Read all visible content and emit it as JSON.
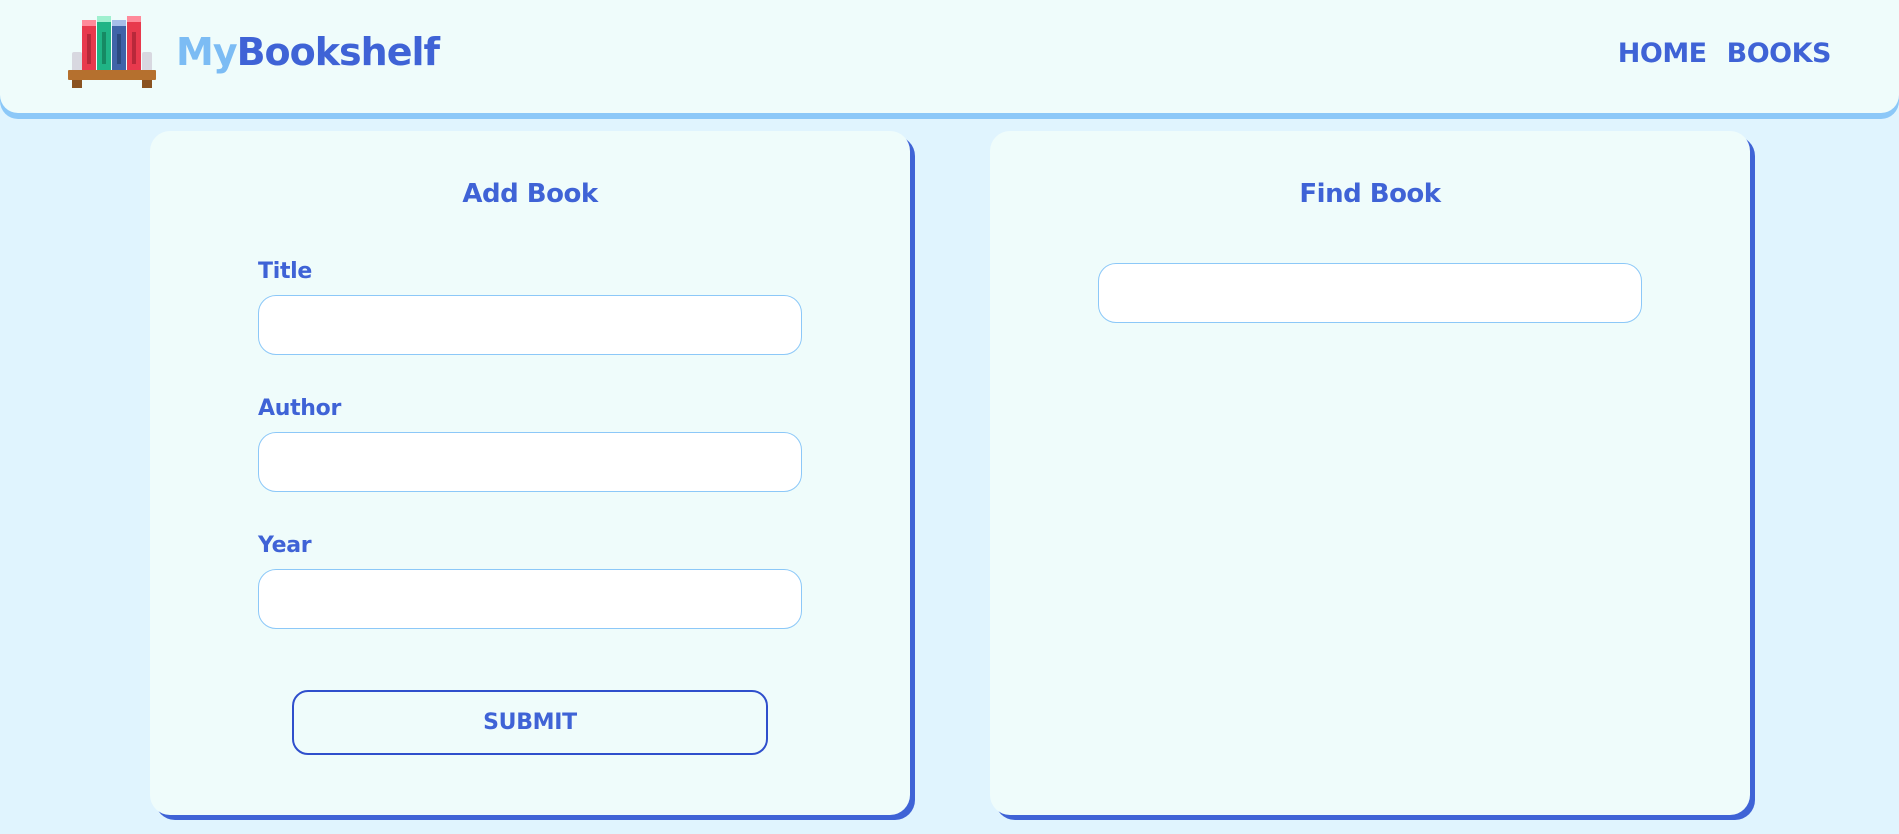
{
  "header": {
    "brand_my": "My",
    "brand_name": "Bookshelf",
    "nav": {
      "home": "HOME",
      "books": "BOOKS"
    }
  },
  "add_book": {
    "title": "Add Book",
    "fields": {
      "title_label": "Title",
      "title_value": "",
      "author_label": "Author",
      "author_value": "",
      "year_label": "Year",
      "year_value": ""
    },
    "submit_label": "SUBMIT"
  },
  "find_book": {
    "title": "Find Book",
    "search_value": ""
  },
  "colors": {
    "background": "#e0f4fe",
    "card": "#effcfb",
    "accent": "#3f63d6",
    "accent_light": "#7cbcf4",
    "input_border": "#8cc8f8"
  },
  "icons": {
    "logo": "bookshelf-icon"
  }
}
